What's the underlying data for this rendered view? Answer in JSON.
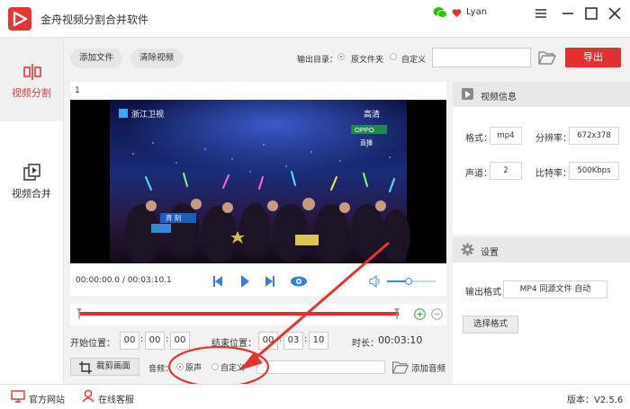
{
  "app": {
    "title": "金舟视频分割合并软件",
    "user_name": "Lyan"
  },
  "sidebar": {
    "items": [
      {
        "label": "视频分割",
        "icon": "split-icon",
        "active": true
      },
      {
        "label": "视频合并",
        "icon": "merge-icon",
        "active": false
      }
    ]
  },
  "toolbar": {
    "add_file": "添加文件",
    "clear_video": "清除视频",
    "output_dir_label": "输出目录：",
    "output_options": [
      "原文件夹",
      "自定义"
    ],
    "output_selected": "原文件夹",
    "output_dir_value": "",
    "export": "导出"
  },
  "player": {
    "index": "1",
    "time": "00:00:00.0 / 00:03:10.1",
    "volume": 0.45,
    "video_overlay": {
      "channel_logo": "浙江卫视",
      "corner_logo": "高清",
      "sponsor": "OPPO",
      "live_tag": "直播",
      "song_title": "斉 刻"
    }
  },
  "timeline": {
    "start_fraction": 0.0,
    "end_fraction": 1.0
  },
  "trim": {
    "start_label": "开始位置：",
    "start": [
      "00",
      "00",
      "00"
    ],
    "end_label": "结束位置：",
    "end": [
      "00",
      "03",
      "10"
    ],
    "duration_label": "时长：",
    "duration": "00:03:10"
  },
  "audio": {
    "crop_button": "裁剪画面",
    "label": "音频：",
    "options": [
      "原声",
      "自定义"
    ],
    "selected": "原声",
    "path": "",
    "add_audio": "添加音频"
  },
  "video_info": {
    "title": "视频信息",
    "format_label": "格式：",
    "format": "mp4",
    "resolution_label": "分辨率：",
    "resolution": "672x378",
    "channels_label": "声道：",
    "channels": "2",
    "bitrate_label": "比特率：",
    "bitrate": "500Kbps"
  },
  "settings": {
    "title": "设置",
    "output_format_label": "输出格式：",
    "output_format": "MP4 同源文件 自动",
    "choose_format": "选择格式"
  },
  "statusbar": {
    "website": "官方网站",
    "service": "在线客服",
    "version": "版本：V2.5.6"
  },
  "colors": {
    "accent": "#e23030",
    "highlight_blue": "#3d7fd6"
  }
}
